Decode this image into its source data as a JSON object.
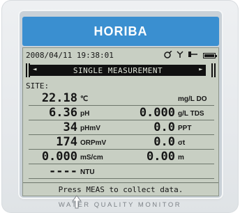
{
  "brand": "HORIBA",
  "status_bar": {
    "datetime": "2008/04/11 19:38:01",
    "icons": [
      "sensor-icon",
      "antenna-icon",
      "probe-icon",
      "battery-icon"
    ],
    "battery_level": 1.0
  },
  "title": {
    "text": "SINGLE MEASUREMENT",
    "left_arrow": "◄",
    "right_arrow": "►"
  },
  "site_label": "SITE:",
  "measurements": [
    {
      "value1": "22.18",
      "unit1": "℃",
      "value2": "",
      "unit2": "mg/L DO"
    },
    {
      "value1": "6.36",
      "unit1": "pH",
      "value2": "0.000",
      "unit2": "g/L TDS"
    },
    {
      "value1": "34",
      "unit1": "pHmV",
      "value2": "0.0",
      "unit2": "PPT"
    },
    {
      "value1": "174",
      "unit1": "ORPmV",
      "value2": "0.0",
      "unit2": "σt"
    },
    {
      "value1": "0.000",
      "unit1": "mS/cm",
      "value2": "0.00",
      "unit2": "m"
    },
    {
      "value1": "----",
      "unit1": "NTU",
      "value2": "",
      "unit2": ""
    }
  ],
  "footer_text": "Press MEAS to collect data.",
  "product_label": "WATER QUALITY MONITOR",
  "colors": {
    "brand_blue": "#3a8fd0",
    "lcd_background": "#c8cfc3",
    "lcd_text": "#161616",
    "bezel": "#c9d1d8"
  }
}
